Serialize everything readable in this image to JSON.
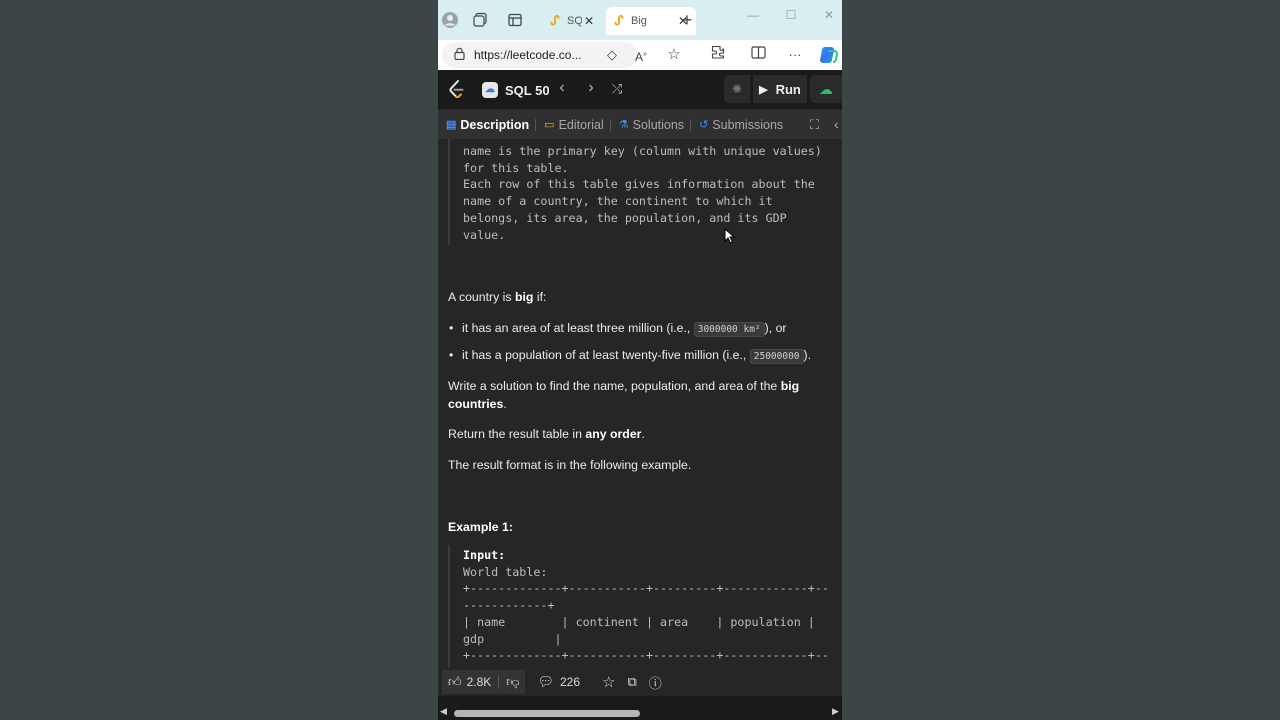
{
  "browser": {
    "tabs": [
      {
        "title": "SQ",
        "icon": "leetcode-favicon"
      },
      {
        "title": "Big",
        "icon": "leetcode-favicon"
      }
    ],
    "url": "https://leetcode.co..."
  },
  "topbar": {
    "problem_list": "SQL 50",
    "run_label": "Run"
  },
  "panel_tabs": [
    {
      "label": "Description",
      "icon": "description-icon"
    },
    {
      "label": "Editorial",
      "icon": "book-icon"
    },
    {
      "label": "Solutions",
      "icon": "flask-icon"
    },
    {
      "label": "Submissions",
      "icon": "history-icon"
    }
  ],
  "schema_text": "name is the primary key (column with unique values)\nfor this table.\nEach row of this table gives information about the\nname of a country, the continent to which it\nbelongs, its area, the population, and its GDP\nvalue.",
  "description": {
    "intro_prefix": "A country is ",
    "intro_bold": "big",
    "intro_suffix": " if:",
    "bullet1_prefix": "it has an area of at least three million (i.e., ",
    "bullet1_code": "3000000 km²",
    "bullet1_suffix": "), or",
    "bullet2_prefix": "it has a population of at least twenty-five million (i.e., ",
    "bullet2_code": "25000000",
    "bullet2_suffix": ").",
    "task_prefix": "Write a solution to find the name, population, and area of the ",
    "task_bold": "big countries",
    "task_suffix": ".",
    "order_prefix": "Return the result table in ",
    "order_bold": "any order",
    "order_suffix": ".",
    "format_text": "The result format is in the following example."
  },
  "example": {
    "heading": "Example 1:",
    "input_label": "Input:",
    "lines": [
      "World table:",
      "+-------------+-----------+---------+------------+--",
      "------------+",
      "| name        | continent | area    | population |",
      "gdp          |",
      "+-------------+-----------+---------+------------+--"
    ]
  },
  "bottom": {
    "likes": "2.8K",
    "comments": "226"
  }
}
